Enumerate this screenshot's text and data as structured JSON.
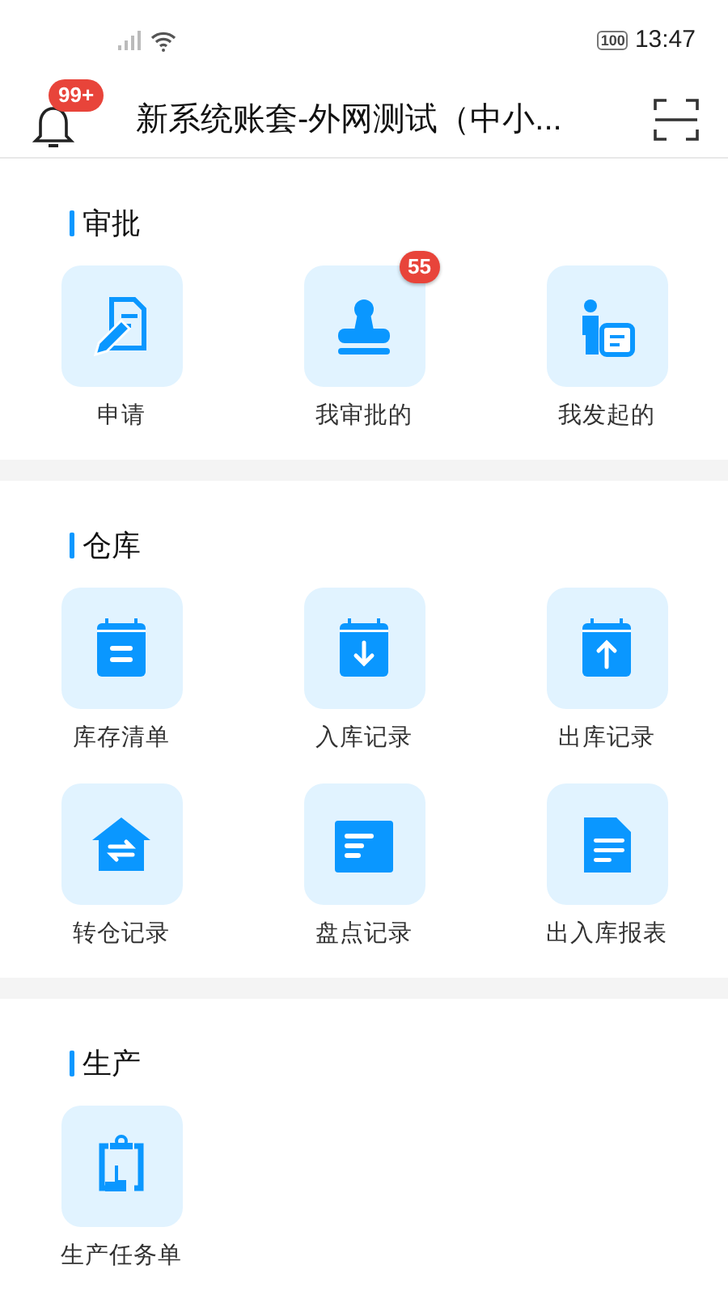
{
  "status_bar": {
    "battery": "100",
    "time": "13:47"
  },
  "header": {
    "bell_badge": "99+",
    "title": "新系统账套-外网测试（中小..."
  },
  "sections": [
    {
      "title": "审批",
      "items": [
        {
          "label": "申请",
          "kind": "form"
        },
        {
          "label": "我审批的",
          "kind": "stamp",
          "badge": "55"
        },
        {
          "label": "我发起的",
          "kind": "person"
        }
      ]
    },
    {
      "title": "仓库",
      "items": [
        {
          "label": "库存清单",
          "kind": "list"
        },
        {
          "label": "入库记录",
          "kind": "inbound"
        },
        {
          "label": "出库记录",
          "kind": "outbound"
        },
        {
          "label": "转仓记录",
          "kind": "transfer"
        },
        {
          "label": "盘点记录",
          "kind": "count"
        },
        {
          "label": "出入库报表",
          "kind": "report"
        }
      ]
    },
    {
      "title": "生产",
      "items": [
        {
          "label": "生产任务单",
          "kind": "task"
        }
      ]
    }
  ]
}
